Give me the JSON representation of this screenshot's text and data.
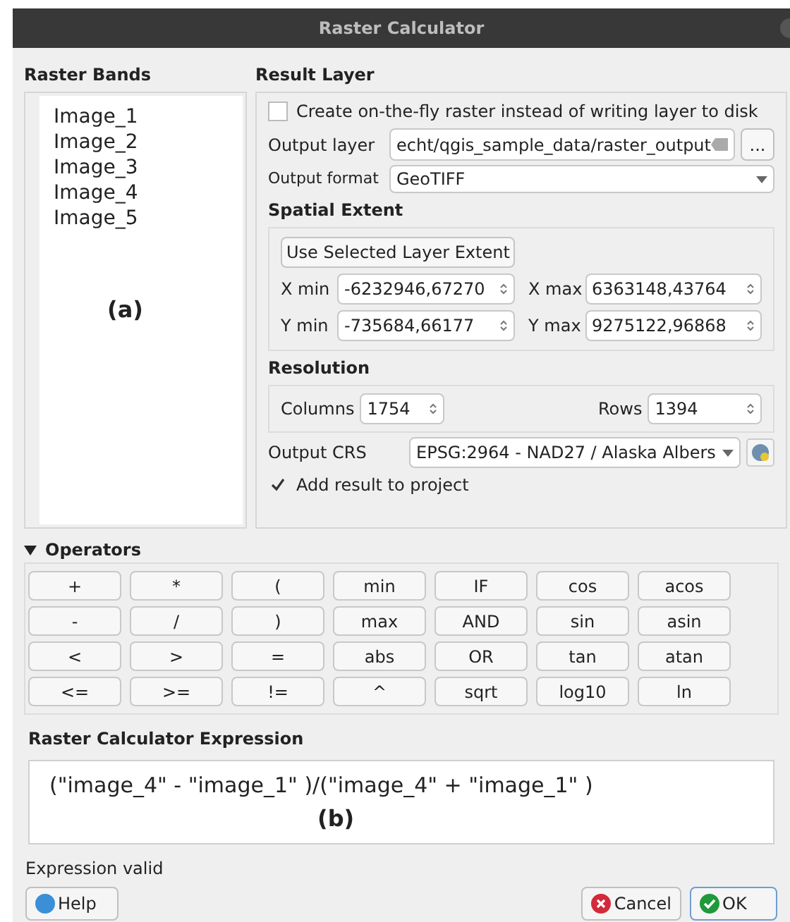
{
  "window": {
    "title": "Raster Calculator"
  },
  "raster_bands": {
    "title": "Raster Bands",
    "items": [
      "Image_1",
      "Image_2",
      "Image_3",
      "Image_4",
      "Image_5"
    ],
    "annotation": "(a)"
  },
  "result_layer": {
    "title": "Result Layer",
    "on_the_fly": {
      "label": "Create on-the-fly raster instead of writing layer to disk",
      "checked": false
    },
    "output_layer": {
      "label": "Output layer",
      "value": "echt/qgis_sample_data/raster_output",
      "browse": "..."
    },
    "output_format": {
      "label": "Output format",
      "value": "GeoTIFF"
    },
    "spatial_extent": {
      "title": "Spatial Extent",
      "button": "Use Selected Layer Extent",
      "fields": [
        {
          "label": "X min",
          "value": "-6232946,67270"
        },
        {
          "label": "X max",
          "value": "6363148,43764"
        },
        {
          "label": "Y min",
          "value": "-735684,66177"
        },
        {
          "label": "Y max",
          "value": "9275122,96868"
        }
      ]
    },
    "resolution": {
      "title": "Resolution",
      "columns": {
        "label": "Columns",
        "value": "1754"
      },
      "rows": {
        "label": "Rows",
        "value": "1394"
      }
    },
    "output_crs": {
      "label": "Output CRS",
      "value": "EPSG:2964 - NAD27 / Alaska Albers"
    },
    "add_to_project": {
      "label": "Add result to project",
      "checked": true
    }
  },
  "operators": {
    "title": "Operators",
    "expanded": true,
    "buttons": [
      "+",
      "*",
      "(",
      "min",
      "IF",
      "cos",
      "acos",
      "-",
      "/",
      ")",
      "max",
      "AND",
      "sin",
      "asin",
      "<",
      ">",
      "=",
      "abs",
      "OR",
      "tan",
      "atan",
      "<=",
      ">=",
      "!=",
      "^",
      "sqrt",
      "log10",
      "ln"
    ]
  },
  "expression": {
    "title": "Raster Calculator Expression",
    "value": "(\"image_4\" - \"image_1\" )/(\"image_4\" + \"image_1\" )",
    "annotation": "(b)"
  },
  "status": "Expression valid",
  "buttons": [
    {
      "label": "Help",
      "kind": "help"
    },
    {
      "label": "Cancel",
      "kind": "cancel"
    },
    {
      "label": "OK",
      "kind": "ok"
    }
  ]
}
